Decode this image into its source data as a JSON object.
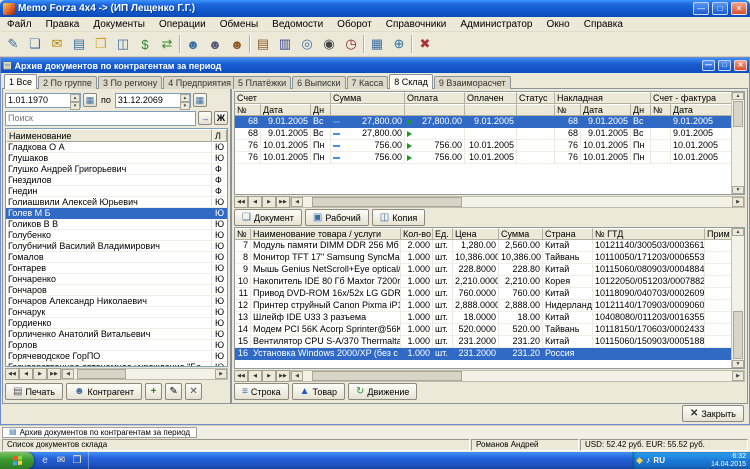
{
  "titlebar": {
    "title": "Memo Forza 4x4 -> (ИП Лещенко Г.Г.)"
  },
  "window_controls": [
    {
      "name": "minimize-button",
      "glyph": "—"
    },
    {
      "name": "maximize-button",
      "glyph": "□"
    },
    {
      "name": "close-button",
      "glyph": "✕"
    }
  ],
  "menu": {
    "items": [
      "Файл",
      "Правка",
      "Документы",
      "Операции",
      "Обмены",
      "Ведомости",
      "Оборот",
      "Справочники",
      "Администратор",
      "Окно",
      "Справка"
    ]
  },
  "toolbar": {
    "icons": [
      {
        "name": "document-edit-icon",
        "glyph": "✎",
        "color": "#3a6ea5"
      },
      {
        "name": "documents-icon",
        "glyph": "❏",
        "color": "#3a6ea5"
      },
      {
        "name": "mail-icon",
        "glyph": "✉",
        "color": "#b8860b"
      },
      {
        "name": "report-icon",
        "glyph": "▤",
        "color": "#3a6ea5"
      },
      {
        "name": "folder-icon",
        "glyph": "❒",
        "color": "#d4a017"
      },
      {
        "name": "copy-document-icon",
        "glyph": "◫",
        "color": "#3a6ea5"
      },
      {
        "name": "money-icon",
        "glyph": "$",
        "color": "#2e8b2e"
      },
      {
        "name": "exchange-icon",
        "glyph": "⇄",
        "color": "#2e8b2e"
      },
      {
        "separator": true
      },
      {
        "name": "user-icon",
        "glyph": "☻",
        "color": "#3a6ea5"
      },
      {
        "name": "user-edit-icon",
        "glyph": "☻",
        "color": "#555577"
      },
      {
        "name": "users-icon",
        "glyph": "☻",
        "color": "#8b5a2b"
      },
      {
        "separator": true
      },
      {
        "name": "ledger-icon",
        "glyph": "▤",
        "color": "#8b5a2b"
      },
      {
        "name": "bar-chart-icon",
        "glyph": "▥",
        "color": "#334488"
      },
      {
        "name": "chart-search-icon",
        "glyph": "◎",
        "color": "#3a6ea5"
      },
      {
        "name": "binoculars-icon",
        "glyph": "◉",
        "color": "#444444"
      },
      {
        "name": "clock-icon",
        "glyph": "◷",
        "color": "#8b2020"
      },
      {
        "separator": true
      },
      {
        "name": "table-icon",
        "glyph": "▦",
        "color": "#3a6ea5"
      },
      {
        "name": "globe-icon",
        "glyph": "⊕",
        "color": "#2e6e9e"
      },
      {
        "separator": true
      },
      {
        "name": "exit-icon",
        "glyph": "✖",
        "color": "#aa3333"
      }
    ]
  },
  "mdi_window": {
    "title": "Архив документов по контрагентам за период",
    "icon": "▤"
  },
  "icons": {
    "spin_up": "▴",
    "spin_down": "▾",
    "calendar": "▦",
    "left": "◀",
    "right": "▶",
    "up": "▲",
    "down": "▼"
  },
  "nav_buttons": [
    {
      "name": "first-record-button",
      "glyph": "◀◀"
    },
    {
      "name": "prior-record-button",
      "glyph": "◀"
    },
    {
      "name": "next-record-button",
      "glyph": "▶"
    },
    {
      "name": "last-record-button",
      "glyph": "▶▶"
    }
  ],
  "left_panel": {
    "tabs": [
      {
        "label": "1 Все",
        "active": true
      },
      {
        "label": "2 По группе"
      },
      {
        "label": "3 По региону"
      },
      {
        "label": "4 Предприятия"
      }
    ],
    "period": {
      "from": "1.01.1970",
      "separator": "по",
      "to": "31.12.2069"
    },
    "search": {
      "placeholder": "Поиск",
      "go_glyph": "→",
      "filter_glyph": "Ж"
    },
    "list": {
      "name_header": "Наименование",
      "type_header": "Л",
      "rows": [
        {
          "name": "Гладкова О А",
          "type": "Ю"
        },
        {
          "name": "Глушаков",
          "type": "Ю"
        },
        {
          "name": "Глушко Андрей Григорьевич",
          "type": "Ф"
        },
        {
          "name": "Гнездилов",
          "type": "Ф"
        },
        {
          "name": "Гнедин",
          "type": "Ф"
        },
        {
          "name": "Голиашвили Алексей Юрьевич",
          "type": "Ю"
        },
        {
          "name": "Голев М Б",
          "type": "Ю",
          "selected": true
        },
        {
          "name": "Голиков В В",
          "type": "Ю"
        },
        {
          "name": "Голубенко",
          "type": "Ю"
        },
        {
          "name": "Голубничий Василий Владимирович",
          "type": "Ю"
        },
        {
          "name": "Гомалов",
          "type": "Ю"
        },
        {
          "name": "Гонтарев",
          "type": "Ю"
        },
        {
          "name": "Гончаренко",
          "type": "Ю"
        },
        {
          "name": "Гончаров",
          "type": "Ю"
        },
        {
          "name": "Гончаров Александр Николаевич",
          "type": "Ю"
        },
        {
          "name": "Гончарук",
          "type": "Ю"
        },
        {
          "name": "Гордиенко",
          "type": "Ю"
        },
        {
          "name": "Горличенко Анатолий Витальевич",
          "type": "Ю"
        },
        {
          "name": "Горлов",
          "type": "Ю"
        },
        {
          "name": "Горячеводское ГорПО",
          "type": "Ю"
        },
        {
          "name": "Государственное автономное учреждение \"Ба",
          "type": "Ю"
        }
      ]
    },
    "buttons": {
      "print": "Печать",
      "print_icon": "▤",
      "contractor": "Контрагент",
      "contractor_icon": "☻",
      "add": "+",
      "edit": "✎",
      "del": "✕"
    }
  },
  "right_panel": {
    "tabs": [
      {
        "label": "5 Платёжки"
      },
      {
        "label": "6 Выписки"
      },
      {
        "label": "7 Касса"
      },
      {
        "label": "8 Склад",
        "active": true
      },
      {
        "label": "9 Взаиморасчет"
      }
    ],
    "invoices": {
      "groups": {
        "account": "Счет",
        "sum": "Сумма",
        "payment": "Оплата",
        "paid": "Оплачен",
        "status": "Статус",
        "waybill": "Накладная",
        "invoice": "Счет - фактура"
      },
      "subs": {
        "num": "№",
        "date": "Дата",
        "day": "Дн"
      },
      "rows": [
        {
          "num": "68",
          "date": "9.01.2005",
          "day": "Вс",
          "sum": "27,800.00",
          "payment": "27,800.00",
          "paid": "9.01.2005",
          "status": "",
          "wb_num": "68",
          "wb_date": "9.01.2005",
          "wb_day": "Вс",
          "inv_num": "",
          "inv_date": "9.01.2005",
          "selected": true
        },
        {
          "num": "68",
          "date": "9.01.2005",
          "day": "Вс",
          "sum": "27,800.00",
          "payment": "",
          "paid": "",
          "status": "",
          "wb_num": "68",
          "wb_date": "9.01.2005",
          "wb_day": "Вс",
          "inv_num": "",
          "inv_date": "9.01.2005"
        },
        {
          "num": "76",
          "date": "10.01.2005",
          "day": "Пн",
          "sum": "756.00",
          "payment": "756.00",
          "paid": "10.01.2005",
          "status": "",
          "wb_num": "76",
          "wb_date": "10.01.2005",
          "wb_day": "Пн",
          "inv_num": "",
          "inv_date": "10.01.2005"
        },
        {
          "num": "76",
          "date": "10.01.2005",
          "day": "Пн",
          "sum": "756.00",
          "payment": "756.00",
          "paid": "10.01.2005",
          "status": "",
          "wb_num": "76",
          "wb_date": "10.01.2005",
          "wb_day": "Пн",
          "inv_num": "",
          "inv_date": "10.01.2005"
        }
      ],
      "buttons": [
        {
          "name": "document-button",
          "label": "Документ",
          "glyph": "❏",
          "color": "#3a6ea5"
        },
        {
          "name": "work-document-button",
          "label": "Рабочий",
          "glyph": "▣",
          "color": "#3a6ea5"
        },
        {
          "name": "copy-button",
          "label": "Копия",
          "glyph": "◫",
          "color": "#3a6ea5"
        }
      ]
    },
    "goods": {
      "headers": {
        "num": "№",
        "name": "Наименование товара / услуги",
        "qty": "Кол-во",
        "unit": "Ед.",
        "price": "Цена",
        "sum": "Сумма",
        "country": "Страна",
        "gtd": "№ ГТД",
        "note": "Прим"
      },
      "rows": [
        {
          "num": "7",
          "name": "Модуль памяти DIMM DDR 256 Mб P",
          "qty": "2.000",
          "unit": "шт.",
          "price": "1,280.00",
          "sum": "2,560.00",
          "country": "Китай",
          "gtd": "10121140/300503/0003661"
        },
        {
          "num": "8",
          "name": "Монитор TFT 17\" Samsung SyncMas",
          "qty": "1.000",
          "unit": "шт.",
          "price": "10,386.0000",
          "sum": "10,386.00",
          "country": "Тайвань",
          "gtd": "10110050/171203/0006553"
        },
        {
          "num": "9",
          "name": "Мышь Genius NetScroll+Eye optical/3",
          "qty": "1.000",
          "unit": "шт.",
          "price": "228.8000",
          "sum": "228.80",
          "country": "Китай",
          "gtd": "10115060/080903/0004884"
        },
        {
          "num": "10",
          "name": "Накопитель IDE 80 Гб Maxtor 7200rp",
          "qty": "1.000",
          "unit": "шт.",
          "price": "2,210.0000",
          "sum": "2,210.00",
          "country": "Корея",
          "gtd": "10122050/051203/0007882"
        },
        {
          "num": "11",
          "name": "Привод DVD-ROM 16x/52x LG GDR-",
          "qty": "1.000",
          "unit": "шт.",
          "price": "760.0000",
          "sum": "760.00",
          "country": "Китай",
          "gtd": "10118090/040703/0002609"
        },
        {
          "num": "12",
          "name": "Принтер струйный Canon Pixma iP1",
          "qty": "1.000",
          "unit": "шт.",
          "price": "2,888.0000",
          "sum": "2,888.00",
          "country": "Нидерланды",
          "gtd": "10121140/170903/0009060"
        },
        {
          "num": "13",
          "name": "Шлейф IDE U33 3 разъема",
          "qty": "1.000",
          "unit": "шт.",
          "price": "18.0000",
          "sum": "18.00",
          "country": "Китай",
          "gtd": "10408080/011203/0016355"
        },
        {
          "num": "14",
          "name": "Модем PCI 56K Acorp Sprinter@56K",
          "qty": "1.000",
          "unit": "шт.",
          "price": "520.0000",
          "sum": "520.00",
          "country": "Тайвань",
          "gtd": "10118150/170603/0002433"
        },
        {
          "num": "15",
          "name": "Вентилятор CPU S-A/370 Thermaltal",
          "qty": "1.000",
          "unit": "шт.",
          "price": "231.2000",
          "sum": "231.20",
          "country": "Китай",
          "gtd": "10115060/150903/0005188"
        },
        {
          "num": "16",
          "name": "Установка Windows 2000/XP (без с",
          "qty": "1.000",
          "unit": "шт.",
          "price": "231.2000",
          "sum": "231.20",
          "country": "Россия",
          "gtd": "",
          "selected": true
        }
      ],
      "buttons": [
        {
          "name": "line-button",
          "label": "Строка",
          "glyph": "≡",
          "color": "#3a6ea5"
        },
        {
          "name": "goods-button",
          "label": "Товар",
          "glyph": "▲",
          "color": "#2255cc"
        },
        {
          "name": "movement-button",
          "label": "Движение",
          "glyph": "↻",
          "color": "#2e8b2e"
        }
      ]
    },
    "close": {
      "label": "Закрыть",
      "icon": "✕"
    }
  },
  "window_tabs": {
    "items": [
      {
        "label": "Архив документов по контрагентам за период",
        "glyph": "▤",
        "active": true
      }
    ]
  },
  "statusbar": {
    "left": "Список документов склада",
    "user": "Романов Андрей",
    "rates": "USD: 52.42 руб.  EUR: 55.52 руб."
  },
  "taskbar": {
    "quick_launch": [
      {
        "name": "internet-explorer-icon",
        "glyph": "e",
        "color": "#cfe6ff"
      },
      {
        "name": "mail-launch-icon",
        "glyph": "✉",
        "color": "#ffe9a8"
      },
      {
        "name": "folder-launch-icon",
        "glyph": "❒",
        "color": "#ffe9a8"
      }
    ],
    "tray": {
      "icons": [
        {
          "name": "antivirus-tray-icon",
          "glyph": "◆",
          "color": "#ffd24a"
        },
        {
          "name": "volume-tray-icon",
          "glyph": "♪",
          "color": "#ffffff"
        }
      ],
      "lang": "RU",
      "time": "6:32",
      "date": "14.04.2015"
    }
  }
}
